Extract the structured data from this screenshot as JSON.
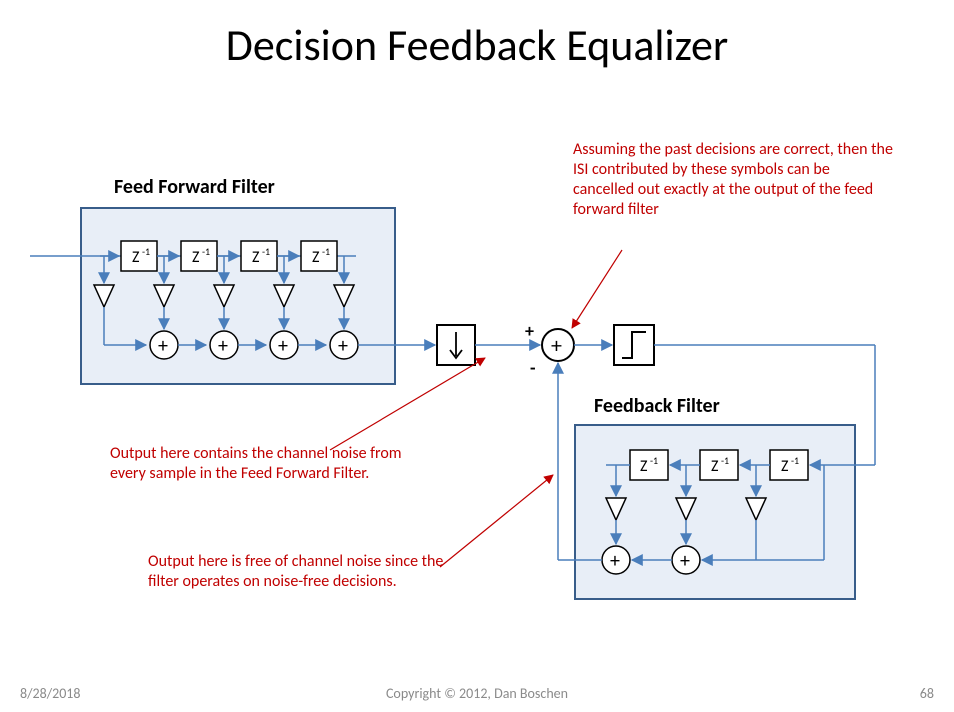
{
  "title": "Decision Feedback Equalizer",
  "labels": {
    "ff": "Feed Forward Filter",
    "fb": "Feedback Filter"
  },
  "delay": "Z",
  "delay_sup": "-1",
  "plus": "+",
  "minus": "-",
  "notes": {
    "top": "Assuming the past decisions are correct, then the ISI contributed by these symbols can be cancelled out exactly at the output of the feed forward filter",
    "mid": "Output here contains the channel noise from every sample in the Feed Forward Filter.",
    "bot": "Output here is free of channel noise since the filter operates on noise-free decisions."
  },
  "footer": {
    "date": "8/28/2018",
    "copyright": "Copyright © 2012, Dan Boschen",
    "page": "68"
  }
}
